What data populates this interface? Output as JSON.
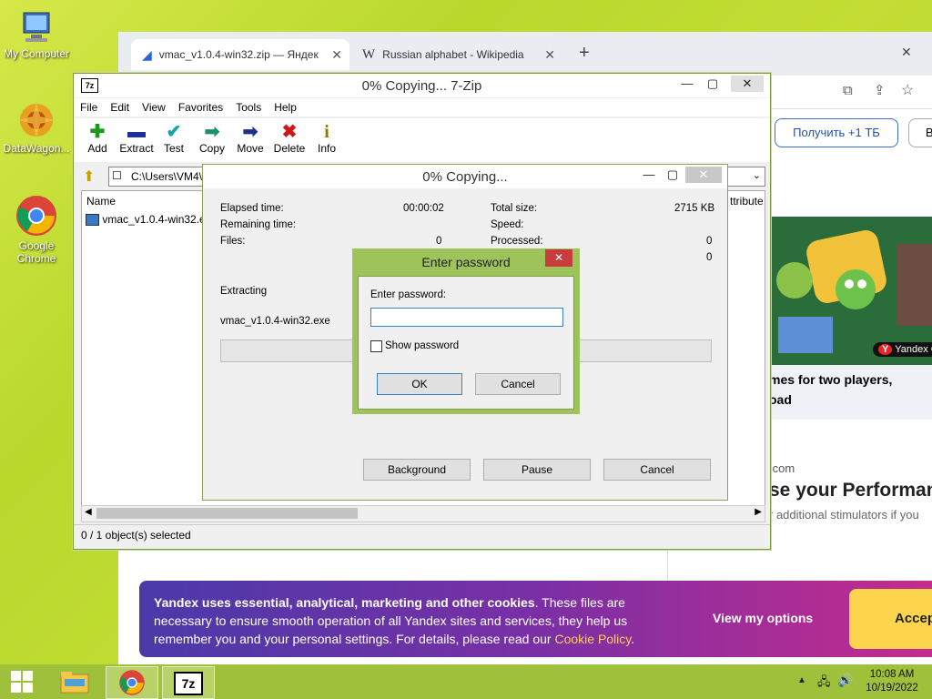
{
  "desktop": {
    "icons": [
      {
        "label": "My Computer",
        "icon": "computer-icon"
      },
      {
        "label": "DataWagon...",
        "icon": "datawagon-icon"
      },
      {
        "label": "Google Chrome",
        "icon": "chrome-icon"
      }
    ]
  },
  "browser": {
    "tabs": [
      {
        "title": "vmac_v1.0.4-win32.zip — Яндекс",
        "icon": "yandex-disk-icon"
      },
      {
        "title": "Russian alphabet - Wikipedia",
        "icon": "wikipedia-icon"
      }
    ],
    "new_tab": "+",
    "get_tb_button": "Получить +1 ТБ",
    "get_tb_partial": "В",
    "game_badge": "Yandex G",
    "game_caption_1": "mes for two players,",
    "game_caption_2": "oad",
    "site_partial": ".com",
    "headline_partial": "se your Performan",
    "sub_partial": "r additional stimulators if you"
  },
  "zip": {
    "title": "0% Copying... 7-Zip",
    "menu": [
      "File",
      "Edit",
      "View",
      "Favorites",
      "Tools",
      "Help"
    ],
    "toolbar": [
      {
        "label": "Add",
        "icon": "add-icon",
        "glyph": "✚",
        "color": "#1a9a1a"
      },
      {
        "label": "Extract",
        "icon": "extract-icon",
        "glyph": "▬",
        "color": "#1c2fa0"
      },
      {
        "label": "Test",
        "icon": "test-icon",
        "glyph": "✔",
        "color": "#15a5a5"
      },
      {
        "label": "Copy",
        "icon": "copy-icon",
        "glyph": "➡",
        "color": "#1a8f6a"
      },
      {
        "label": "Move",
        "icon": "move-icon",
        "glyph": "➡",
        "color": "#1c2f8a"
      },
      {
        "label": "Delete",
        "icon": "delete-icon",
        "glyph": "✖",
        "color": "#d01818"
      },
      {
        "label": "Info",
        "icon": "info-icon",
        "glyph": "i",
        "color": "#8a7a00"
      }
    ],
    "path": "C:\\Users\\VM4\\",
    "column_name": "Name",
    "column_attr": "ttribute",
    "file_name": "vmac_v1.0.4-win32.ex",
    "status": "0 / 1 object(s) selected"
  },
  "copy": {
    "title": "0% Copying...",
    "elapsed_label": "Elapsed time:",
    "elapsed_value": "00:00:02",
    "remaining_label": "Remaining time:",
    "files_label": "Files:",
    "files_value": "0",
    "total_label": "Total size:",
    "total_value": "2715 KB",
    "speed_label": "Speed:",
    "processed_label": "Processed:",
    "processed_value": "0",
    "extra_value": "0",
    "action_label": "Extracting",
    "current_file": "vmac_v1.0.4-win32.exe",
    "background_btn": "Background",
    "pause_btn": "Pause",
    "cancel_btn": "Cancel"
  },
  "password": {
    "title": "Enter password",
    "field_label": "Enter password:",
    "field_value": "",
    "show_label": "Show password",
    "ok": "OK",
    "cancel": "Cancel"
  },
  "cookie": {
    "bold": "Yandex uses essential, analytical, marketing and other cookies",
    "text_1": ". These files are",
    "text_2": "necessary to ensure smooth operation of all Yandex sites and services, they help us",
    "text_3": "remember you and your personal settings. For details, please read our",
    "link": "Cookie Policy",
    "text_end": ".",
    "options": "View my options",
    "accept": "Accep"
  },
  "taskbar": {
    "time": "10:08 AM",
    "date": "10/19/2022"
  }
}
